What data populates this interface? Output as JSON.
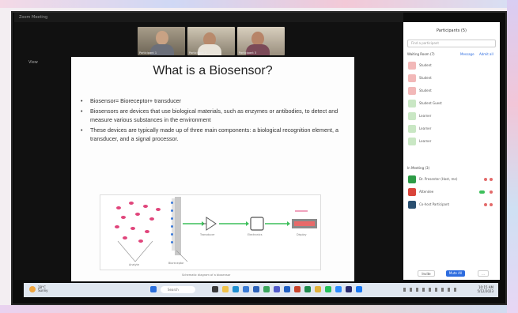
{
  "window": {
    "title": "Zoom Meeting",
    "view_label": "View"
  },
  "video_thumbnails": [
    {
      "name": "Participant 1"
    },
    {
      "name": "Participant 2"
    },
    {
      "name": "Participant 3"
    }
  ],
  "slide": {
    "title": "What is a Biosensor?",
    "bullets": [
      "Biosensor= Bioreceptor+ transducer",
      "Biosensors are devices that use biological materials, such as enzymes or antibodies, to detect and measure various substances in the environment",
      "These devices are typically made up of three main components: a biological recognition element, a transducer, and a signal processor."
    ],
    "diagram": {
      "captions": [
        "Analyte",
        "Bioreceptor",
        "Transducer",
        "Electronics",
        "Display"
      ],
      "footer": "Schematic diagram of a biosensor"
    }
  },
  "participants_panel": {
    "title": "Participants (5)",
    "search_placeholder": "Find a participant",
    "waiting_header": "Waiting Room (7)",
    "message_link": "Message",
    "admit_all_link": "Admit all",
    "waiting": [
      {
        "name": "Student",
        "color": "#f2b8b8"
      },
      {
        "name": "Student",
        "color": "#f2b8b8"
      },
      {
        "name": "Student",
        "color": "#f2b8b8"
      },
      {
        "name": "Student Guest",
        "color": "#c9e7c4"
      },
      {
        "name": "Learner",
        "color": "#c9e7c4"
      },
      {
        "name": "Learner",
        "color": "#c9e7c4"
      },
      {
        "name": "Learner",
        "color": "#c9e7c4"
      }
    ],
    "in_meeting_header": "In Meeting (3)",
    "in_meeting": [
      {
        "name": "Dr. Presenter (Host, me)",
        "color": "#2e9c47"
      },
      {
        "name": "Attendee",
        "color": "#d9443b"
      },
      {
        "name": "Co-host Participant",
        "color": "#2a4f70"
      }
    ],
    "invite_label": "Invite",
    "mute_all_label": "Mute All",
    "more_label": "..."
  },
  "taskbar": {
    "weather_temp": "28°C",
    "weather_desc": "Sunny",
    "search_placeholder": "Search",
    "time": "10:15 AM",
    "date": "5/12/2023"
  },
  "colors": {
    "accent": "#2d6cdf",
    "analyte": "#e0457b",
    "arrow": "#3cbf5a"
  }
}
